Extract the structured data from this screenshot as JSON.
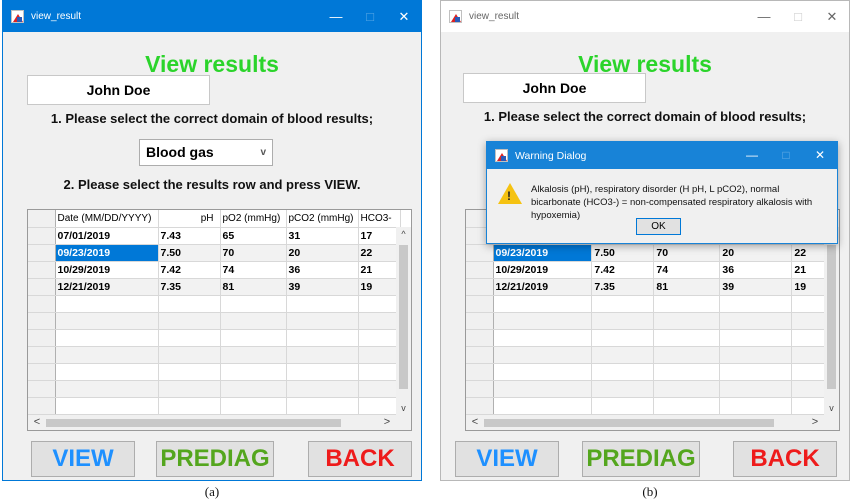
{
  "panels": [
    {
      "window_title": "view_result",
      "heading": "View results",
      "patient_name": "John Doe",
      "step1": "1. Please select the correct domain of blood results;",
      "domain_selected": "Blood gas",
      "step2": "2. Please select the results row and press VIEW.",
      "caption": "(a)"
    },
    {
      "window_title": "view_result",
      "heading": "View results",
      "patient_name": "John Doe",
      "step1": "1. Please select the correct domain of blood results;",
      "caption": "(b)"
    }
  ],
  "window_controls": {
    "minimize": "—",
    "maximize": "□",
    "close": "✕"
  },
  "table": {
    "headers": [
      "Date (MM/DD/YYYY)",
      "pH",
      "pO2 (mmHg)",
      "pCO2 (mmHg)",
      "HCO3-"
    ],
    "rows": [
      [
        "07/01/2019",
        "7.43",
        "65",
        "31",
        "17"
      ],
      [
        "09/23/2019",
        "7.50",
        "70",
        "20",
        "22"
      ],
      [
        "10/29/2019",
        "7.42",
        "74",
        "36",
        "21"
      ],
      [
        "12/21/2019",
        "7.35",
        "81",
        "39",
        "19"
      ]
    ],
    "selected_row": 1
  },
  "buttons": {
    "view": "VIEW",
    "prediag": "PREDIAG",
    "back": "BACK"
  },
  "scroll_glyphs": {
    "up": "^",
    "down": "v",
    "left": "<",
    "right": ">"
  },
  "dropdown_caret": "v",
  "dialog": {
    "title": "Warning Dialog",
    "message": "Alkalosis (pH), respiratory disorder (H pH, L pCO2), normal bicarbonate (HCO3-) = non-compensated respiratory alkalosis with hypoxemia)",
    "ok_label": "OK",
    "warning_mark": "!"
  },
  "colors": {
    "heading": "#2bd42b",
    "view_button": "#1e90ff",
    "prediag_button": "#54a61e",
    "back_button": "#ee1b1b",
    "selection": "#0078d7"
  }
}
